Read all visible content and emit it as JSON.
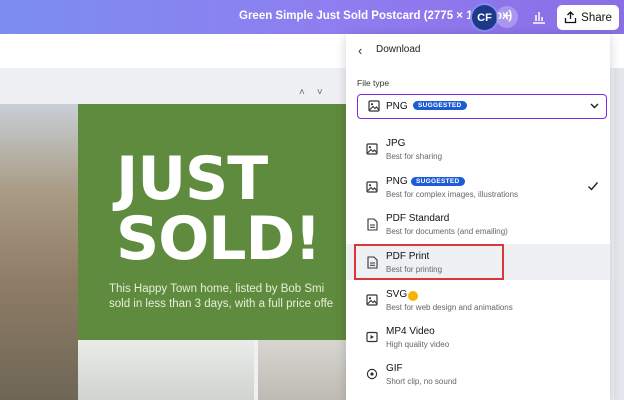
{
  "header": {
    "doc_title": "Green Simple Just Sold Postcard (2775 × 1875 px)",
    "avatar_initials": "CF",
    "plus": "+",
    "share_label": "Share"
  },
  "canvas": {
    "pager": "^v",
    "headline_line1": "JUST",
    "headline_line2": "SOLD!",
    "desc_line1": "This Happy Town home, listed by Bob Smi",
    "desc_line2": "sold in less than 3 days, with a full price offe"
  },
  "download_panel": {
    "back_icon": "chevron-left-icon",
    "title": "Download",
    "file_type_label": "File type",
    "selected": {
      "label": "PNG",
      "badge": "SUGGESTED"
    },
    "options": [
      {
        "label": "JPG",
        "sub": "Best for sharing",
        "icon": "image-icon"
      },
      {
        "label": "PNG",
        "badge": "SUGGESTED",
        "sub": "Best for complex images, illustrations",
        "icon": "image-icon",
        "checked": true
      },
      {
        "label": "PDF Standard",
        "sub": "Best for documents (and emailing)",
        "icon": "document-icon"
      },
      {
        "label": "PDF Print",
        "sub": "Best for printing",
        "icon": "document-icon",
        "highlighted": true
      },
      {
        "label": "SVG",
        "sub": "Best for web design and animations",
        "icon": "image-icon",
        "pro": true
      },
      {
        "label": "MP4 Video",
        "sub": "High quality video",
        "icon": "video-icon"
      },
      {
        "label": "GIF",
        "sub": "Short clip, no sound",
        "icon": "gif-icon"
      }
    ]
  },
  "colors": {
    "accent": "#7d2ae8",
    "badge": "#1e5cd6",
    "highlight_border": "#d9383a",
    "canvas_green": "#5f8b3e"
  }
}
